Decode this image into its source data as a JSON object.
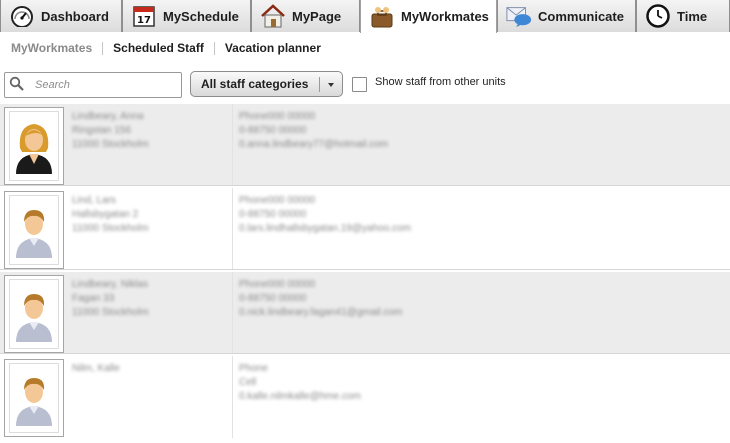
{
  "tabs": [
    {
      "label": "Dashboard",
      "icon": "speedometer-icon"
    },
    {
      "label": "MySchedule",
      "icon": "calendar-icon",
      "icon_text": "17"
    },
    {
      "label": "MyPage",
      "icon": "house-icon"
    },
    {
      "label": "MyWorkmates",
      "icon": "briefcase-people-icon",
      "active": true
    },
    {
      "label": "Communicate",
      "icon": "envelope-speech-icon"
    },
    {
      "label": "Time",
      "icon": "clock-icon"
    }
  ],
  "subnav": {
    "items": [
      "MyWorkmates",
      "Scheduled Staff",
      "Vacation planner"
    ],
    "active_index": 0
  },
  "toolbar": {
    "search_placeholder": "Search",
    "category_dropdown": "All staff categories",
    "show_other_units_label": "Show staff from other units",
    "show_other_units_checked": false
  },
  "staff": [
    {
      "avatar": "female-person-icon",
      "name_lines": [
        "Lindbeary, Anna",
        "Ringstan 156",
        "11000 Stockholm"
      ],
      "contact_lines": [
        "Phone000 00000",
        "0-88750 00000",
        "0.anna.lindbeary77@hotmail.com"
      ],
      "shaded": true
    },
    {
      "avatar": "male-person-icon",
      "name_lines": [
        "Lind, Lars",
        "Hallsbygatan 2",
        "11000 Stockholm"
      ],
      "contact_lines": [
        "Phone000 00000",
        "0-88750 00000",
        "0.lars.lindhallsbygatan.19@yahoo.com"
      ],
      "shaded": false
    },
    {
      "avatar": "male-person-icon",
      "name_lines": [
        "Lindbeary, Niklas",
        "Fagan 33",
        "11000 Stockholm"
      ],
      "contact_lines": [
        "Phone000 00000",
        "0-88750 00000",
        "0.nick.lindbeary.fagan41@gmail.com"
      ],
      "shaded": true
    },
    {
      "avatar": "male-person-icon",
      "name_lines": [
        "Nilm, Kalle"
      ],
      "contact_lines": [
        "Phone",
        "Cell",
        "0.kalle.nilmkalle@hme.com"
      ],
      "shaded": false
    }
  ],
  "colors": {
    "tab_bg_top": "#f4f4f4",
    "tab_bg_bottom": "#dcdcdc",
    "row_shade": "#ececec",
    "subnav_active": "#8a8a8a"
  }
}
